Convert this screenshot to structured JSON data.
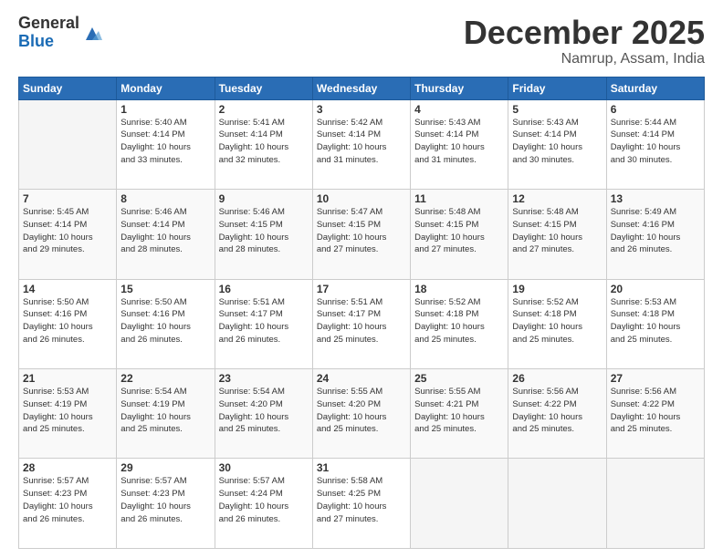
{
  "logo": {
    "general": "General",
    "blue": "Blue"
  },
  "header": {
    "month": "December 2025",
    "location": "Namrup, Assam, India"
  },
  "weekdays": [
    "Sunday",
    "Monday",
    "Tuesday",
    "Wednesday",
    "Thursday",
    "Friday",
    "Saturday"
  ],
  "weeks": [
    [
      {
        "day": "",
        "info": ""
      },
      {
        "day": "1",
        "info": "Sunrise: 5:40 AM\nSunset: 4:14 PM\nDaylight: 10 hours\nand 33 minutes."
      },
      {
        "day": "2",
        "info": "Sunrise: 5:41 AM\nSunset: 4:14 PM\nDaylight: 10 hours\nand 32 minutes."
      },
      {
        "day": "3",
        "info": "Sunrise: 5:42 AM\nSunset: 4:14 PM\nDaylight: 10 hours\nand 31 minutes."
      },
      {
        "day": "4",
        "info": "Sunrise: 5:43 AM\nSunset: 4:14 PM\nDaylight: 10 hours\nand 31 minutes."
      },
      {
        "day": "5",
        "info": "Sunrise: 5:43 AM\nSunset: 4:14 PM\nDaylight: 10 hours\nand 30 minutes."
      },
      {
        "day": "6",
        "info": "Sunrise: 5:44 AM\nSunset: 4:14 PM\nDaylight: 10 hours\nand 30 minutes."
      }
    ],
    [
      {
        "day": "7",
        "info": "Sunrise: 5:45 AM\nSunset: 4:14 PM\nDaylight: 10 hours\nand 29 minutes."
      },
      {
        "day": "8",
        "info": "Sunrise: 5:46 AM\nSunset: 4:14 PM\nDaylight: 10 hours\nand 28 minutes."
      },
      {
        "day": "9",
        "info": "Sunrise: 5:46 AM\nSunset: 4:15 PM\nDaylight: 10 hours\nand 28 minutes."
      },
      {
        "day": "10",
        "info": "Sunrise: 5:47 AM\nSunset: 4:15 PM\nDaylight: 10 hours\nand 27 minutes."
      },
      {
        "day": "11",
        "info": "Sunrise: 5:48 AM\nSunset: 4:15 PM\nDaylight: 10 hours\nand 27 minutes."
      },
      {
        "day": "12",
        "info": "Sunrise: 5:48 AM\nSunset: 4:15 PM\nDaylight: 10 hours\nand 27 minutes."
      },
      {
        "day": "13",
        "info": "Sunrise: 5:49 AM\nSunset: 4:16 PM\nDaylight: 10 hours\nand 26 minutes."
      }
    ],
    [
      {
        "day": "14",
        "info": "Sunrise: 5:50 AM\nSunset: 4:16 PM\nDaylight: 10 hours\nand 26 minutes."
      },
      {
        "day": "15",
        "info": "Sunrise: 5:50 AM\nSunset: 4:16 PM\nDaylight: 10 hours\nand 26 minutes."
      },
      {
        "day": "16",
        "info": "Sunrise: 5:51 AM\nSunset: 4:17 PM\nDaylight: 10 hours\nand 26 minutes."
      },
      {
        "day": "17",
        "info": "Sunrise: 5:51 AM\nSunset: 4:17 PM\nDaylight: 10 hours\nand 25 minutes."
      },
      {
        "day": "18",
        "info": "Sunrise: 5:52 AM\nSunset: 4:18 PM\nDaylight: 10 hours\nand 25 minutes."
      },
      {
        "day": "19",
        "info": "Sunrise: 5:52 AM\nSunset: 4:18 PM\nDaylight: 10 hours\nand 25 minutes."
      },
      {
        "day": "20",
        "info": "Sunrise: 5:53 AM\nSunset: 4:18 PM\nDaylight: 10 hours\nand 25 minutes."
      }
    ],
    [
      {
        "day": "21",
        "info": "Sunrise: 5:53 AM\nSunset: 4:19 PM\nDaylight: 10 hours\nand 25 minutes."
      },
      {
        "day": "22",
        "info": "Sunrise: 5:54 AM\nSunset: 4:19 PM\nDaylight: 10 hours\nand 25 minutes."
      },
      {
        "day": "23",
        "info": "Sunrise: 5:54 AM\nSunset: 4:20 PM\nDaylight: 10 hours\nand 25 minutes."
      },
      {
        "day": "24",
        "info": "Sunrise: 5:55 AM\nSunset: 4:20 PM\nDaylight: 10 hours\nand 25 minutes."
      },
      {
        "day": "25",
        "info": "Sunrise: 5:55 AM\nSunset: 4:21 PM\nDaylight: 10 hours\nand 25 minutes."
      },
      {
        "day": "26",
        "info": "Sunrise: 5:56 AM\nSunset: 4:22 PM\nDaylight: 10 hours\nand 25 minutes."
      },
      {
        "day": "27",
        "info": "Sunrise: 5:56 AM\nSunset: 4:22 PM\nDaylight: 10 hours\nand 25 minutes."
      }
    ],
    [
      {
        "day": "28",
        "info": "Sunrise: 5:57 AM\nSunset: 4:23 PM\nDaylight: 10 hours\nand 26 minutes."
      },
      {
        "day": "29",
        "info": "Sunrise: 5:57 AM\nSunset: 4:23 PM\nDaylight: 10 hours\nand 26 minutes."
      },
      {
        "day": "30",
        "info": "Sunrise: 5:57 AM\nSunset: 4:24 PM\nDaylight: 10 hours\nand 26 minutes."
      },
      {
        "day": "31",
        "info": "Sunrise: 5:58 AM\nSunset: 4:25 PM\nDaylight: 10 hours\nand 27 minutes."
      },
      {
        "day": "",
        "info": ""
      },
      {
        "day": "",
        "info": ""
      },
      {
        "day": "",
        "info": ""
      }
    ]
  ]
}
